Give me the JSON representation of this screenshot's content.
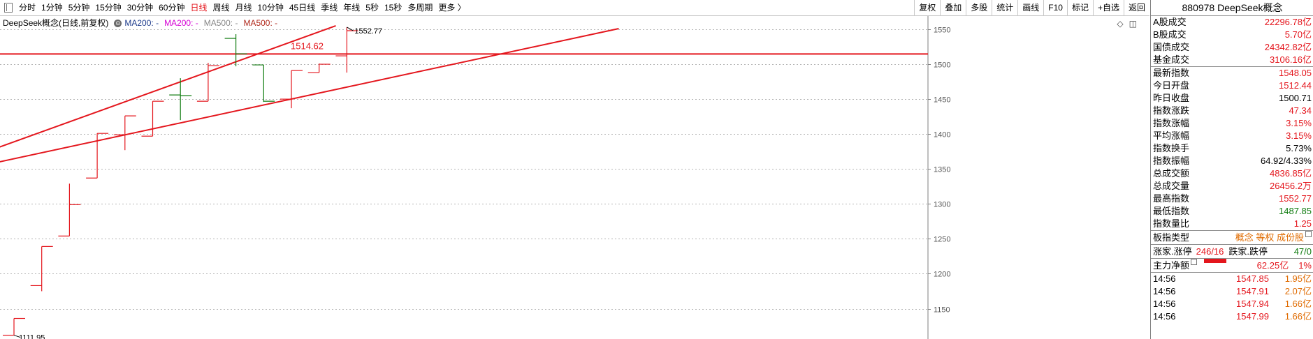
{
  "toolbar": {
    "periods": [
      {
        "label": "分时",
        "active": false
      },
      {
        "label": "1分钟",
        "active": false
      },
      {
        "label": "5分钟",
        "active": false
      },
      {
        "label": "15分钟",
        "active": false
      },
      {
        "label": "30分钟",
        "active": false
      },
      {
        "label": "60分钟",
        "active": false
      },
      {
        "label": "日线",
        "active": true
      },
      {
        "label": "周线",
        "active": false
      },
      {
        "label": "月线",
        "active": false
      },
      {
        "label": "10分钟",
        "active": false
      },
      {
        "label": "45日线",
        "active": false
      },
      {
        "label": "季线",
        "active": false
      },
      {
        "label": "年线",
        "active": false
      },
      {
        "label": "5秒",
        "active": false
      },
      {
        "label": "15秒",
        "active": false
      },
      {
        "label": "多周期",
        "active": false
      },
      {
        "label": "更多 〉",
        "active": false
      }
    ],
    "buttons": [
      "复权",
      "叠加",
      "多股",
      "统计",
      "画线",
      "F10",
      "标记",
      "+自选",
      "返回"
    ]
  },
  "chart": {
    "header_title": "DeepSeek概念(日线,前复权)",
    "ma200_label": "MA200: -",
    "ma200_b_label": "MA200: -",
    "ma500_label": "MA500: -",
    "ma500_b_label": "MA500: -",
    "tools": [
      "◇",
      "◫"
    ],
    "high_label": "1552.77",
    "low_label": "1111.95",
    "hline_label": "1514.62",
    "colors": {
      "up": "#e4161d",
      "down": "#107c10",
      "line": "#e4161d",
      "grid": "#b4b4b4"
    }
  },
  "chart_data": {
    "type": "candlestick",
    "ylim": [
      1111.95,
      1552.77
    ],
    "yticks": [
      1150,
      1200,
      1250,
      1300,
      1350,
      1400,
      1450,
      1500,
      1550
    ],
    "ohlc": [
      {
        "o": 1112,
        "h": 1136,
        "l": 1112,
        "c": 1136
      },
      {
        "o": 1183,
        "h": 1239,
        "l": 1175,
        "c": 1239
      },
      {
        "o": 1254,
        "h": 1329,
        "l": 1254,
        "c": 1299
      },
      {
        "o": 1337,
        "h": 1401,
        "l": 1337,
        "c": 1401
      },
      {
        "o": 1399,
        "h": 1426,
        "l": 1377,
        "c": 1426
      },
      {
        "o": 1397,
        "h": 1447,
        "l": 1397,
        "c": 1447
      },
      {
        "o": 1456,
        "h": 1480,
        "l": 1420,
        "c": 1455
      },
      {
        "o": 1447,
        "h": 1502,
        "l": 1447,
        "c": 1498
      },
      {
        "o": 1537,
        "h": 1543,
        "l": 1497,
        "c": 1515
      },
      {
        "o": 1499,
        "h": 1499,
        "l": 1446,
        "c": 1447
      },
      {
        "o": 1450,
        "h": 1491,
        "l": 1437,
        "c": 1491
      },
      {
        "o": 1488,
        "h": 1501,
        "l": 1488,
        "c": 1500
      },
      {
        "o": 1512,
        "h": 1553,
        "l": 1488,
        "c": 1548
      }
    ],
    "horizontal_line": 1514.62,
    "trendlines": [
      {
        "from": {
          "bar": -0.9,
          "value": 1376
        },
        "to": {
          "bar": 11.6,
          "value": 1555
        }
      },
      {
        "from": {
          "bar": -0.9,
          "value": 1357
        },
        "to": {
          "bar": 21.8,
          "value": 1551
        }
      }
    ]
  },
  "panel": {
    "title": "880978 DeepSeek概念",
    "section1": [
      {
        "label": "A股成交",
        "value": "22296.78亿",
        "color": "red"
      },
      {
        "label": "B股成交",
        "value": "5.70亿",
        "color": "red"
      },
      {
        "label": "国债成交",
        "value": "24342.82亿",
        "color": "red"
      },
      {
        "label": "基金成交",
        "value": "3106.16亿",
        "color": "red"
      }
    ],
    "section2": [
      {
        "label": "最新指数",
        "value": "1548.05",
        "color": "red"
      },
      {
        "label": "今日开盘",
        "value": "1512.44",
        "color": "red"
      },
      {
        "label": "昨日收盘",
        "value": "1500.71",
        "color": "black"
      },
      {
        "label": "指数涨跌",
        "value": "47.34",
        "color": "red"
      },
      {
        "label": "指数涨幅",
        "value": "3.15%",
        "color": "red"
      },
      {
        "label": "平均涨幅",
        "value": "3.15%",
        "color": "red"
      },
      {
        "label": "指数换手",
        "value": "5.73%",
        "color": "black"
      },
      {
        "label": "指数振幅",
        "value": "64.92/4.33%",
        "color": "black"
      },
      {
        "label": "总成交额",
        "value": "4836.85亿",
        "color": "red"
      },
      {
        "label": "总成交量",
        "value": "26456.2万",
        "color": "red"
      },
      {
        "label": "最高指数",
        "value": "1552.77",
        "color": "red"
      },
      {
        "label": "最低指数",
        "value": "1487.85",
        "color": "green"
      },
      {
        "label": "指数量比",
        "value": "1.25",
        "color": "red"
      }
    ],
    "type_label": "板指类型",
    "type_tags": "概念 等权 成份股",
    "limit_label": "涨家.涨停",
    "limit_value": "246/16",
    "fall_label": "跌家.跌停",
    "fall_value": "47/0",
    "flow_label": "主力净额",
    "flow_value": "62.25亿",
    "flow_pct": "1%",
    "ticks": [
      {
        "time": "14:56",
        "price": "1547.85",
        "amount": "1.95亿"
      },
      {
        "time": "14:56",
        "price": "1547.91",
        "amount": "2.07亿"
      },
      {
        "time": "14:56",
        "price": "1547.94",
        "amount": "1.66亿"
      },
      {
        "time": "14:56",
        "price": "1547.99",
        "amount": "1.66亿"
      }
    ]
  }
}
